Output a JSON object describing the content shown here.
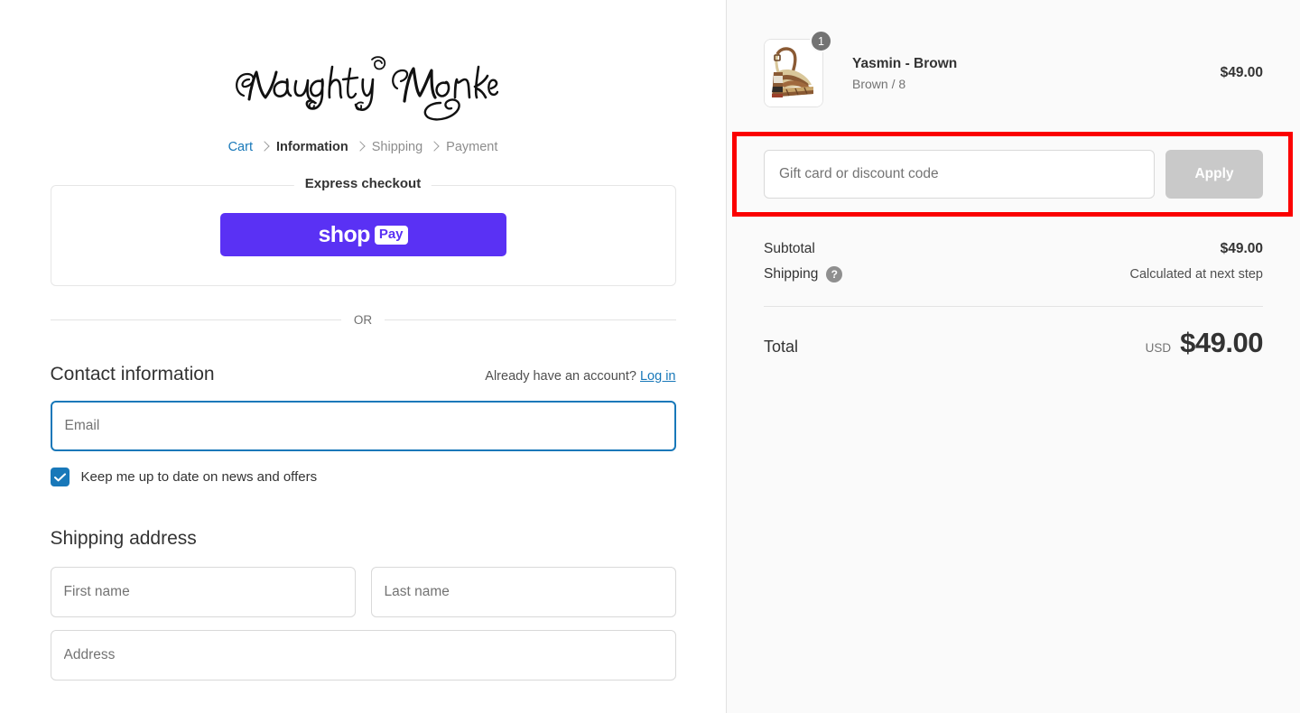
{
  "brand": {
    "logo_text": "Naughty Monkey",
    "logo_alt": "naughty-monkey-script-logo"
  },
  "breadcrumb": {
    "items": [
      {
        "label": "Cart",
        "state": "link"
      },
      {
        "label": "Information",
        "state": "current"
      },
      {
        "label": "Shipping",
        "state": "future"
      },
      {
        "label": "Payment",
        "state": "future"
      }
    ]
  },
  "express": {
    "legend": "Express checkout",
    "shop_pay": {
      "word": "shop",
      "pill": "Pay"
    },
    "or_label": "OR"
  },
  "contact": {
    "title": "Contact information",
    "account_note": "Already have an account?",
    "login_label": "Log in",
    "email_placeholder": "Email",
    "email_value": "",
    "newsletter_label": "Keep me up to date on news and offers",
    "newsletter_checked": true,
    "check_glyph": "✓"
  },
  "shipping_address": {
    "title": "Shipping address",
    "first_name_placeholder": "First name",
    "first_name_value": "",
    "last_name_placeholder": "Last name",
    "last_name_value": "",
    "address_placeholder": "Address",
    "address_value": ""
  },
  "order_summary": {
    "items": [
      {
        "title": "Yasmin - Brown",
        "variant": "Brown / 8",
        "price": "$49.00",
        "quantity": "1",
        "image_alt": "brown-platform-heel-sandal"
      }
    ],
    "discount": {
      "placeholder": "Gift card or discount code",
      "value": "",
      "apply_label": "Apply",
      "apply_disabled": true,
      "highlight_color": "#fb0000"
    },
    "totals": {
      "subtotal_label": "Subtotal",
      "subtotal_value": "$49.00",
      "shipping_label": "Shipping",
      "shipping_help_glyph": "?",
      "shipping_value": "Calculated at next step",
      "total_label": "Total",
      "total_currency": "USD",
      "total_value": "$49.00"
    }
  },
  "colors": {
    "accent_blue": "#1878b9",
    "shop_pay_purple": "#5a31f4",
    "panel_bg": "#fafafa",
    "annotation_red": "#fb0000"
  }
}
